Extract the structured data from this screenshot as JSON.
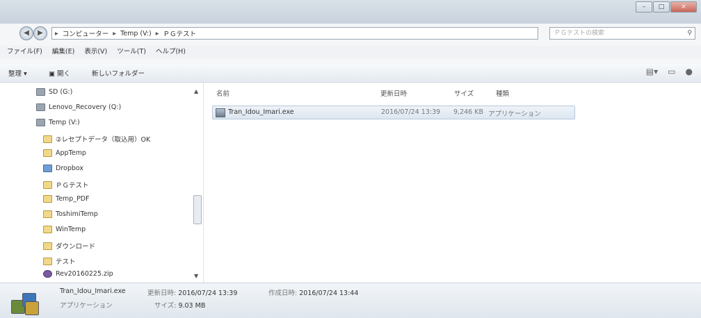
{
  "window": {
    "buttons": [
      "–",
      "□",
      "×"
    ]
  },
  "nav": {
    "back_icon": "back-arrow-icon",
    "forward_icon": "forward-arrow-icon",
    "breadcrumb": [
      "コンピューター",
      "Temp (V:)",
      "ＰＧテスト"
    ],
    "search_placeholder": "ＰＧテストの検索"
  },
  "menu": [
    "ファイル(F)",
    "編集(E)",
    "表示(V)",
    "ツール(T)",
    "ヘルプ(H)"
  ],
  "toolbar": {
    "organize": "整理 ▾",
    "open": "開く",
    "new_folder": "新しいフォルダー"
  },
  "navpane": {
    "items": [
      {
        "label": "SD (G:)",
        "icon": "drive"
      },
      {
        "label": "Lenovo_Recovery (Q:)",
        "icon": "drive"
      },
      {
        "label": "Temp (V:)",
        "icon": "drive"
      },
      {
        "label": "②レセプトデータ（取込用）OK",
        "icon": "folder"
      },
      {
        "label": "AppTemp",
        "icon": "folder"
      },
      {
        "label": "Dropbox",
        "icon": "box"
      },
      {
        "label": "ＰＧテスト",
        "icon": "folder"
      },
      {
        "label": "Temp_PDF",
        "icon": "folder"
      },
      {
        "label": "ToshimiTemp",
        "icon": "folder"
      },
      {
        "label": "WinTemp",
        "icon": "folder"
      },
      {
        "label": "ダウンロード",
        "icon": "folder"
      },
      {
        "label": "テスト",
        "icon": "folder"
      },
      {
        "label": "Rev20160225.zip",
        "icon": "zip"
      }
    ]
  },
  "list": {
    "columns": [
      "名前",
      "更新日時",
      "サイズ",
      "種類"
    ],
    "rows": [
      {
        "name": "Tran_Idou_Imari.exe",
        "modified": "2016/07/24 13:39",
        "size": "9,246 KB",
        "type": "アプリケーション"
      }
    ]
  },
  "details": {
    "filename": "Tran_Idou_Imari.exe",
    "modified_label": "更新日時:",
    "modified": "2016/07/24 13:39",
    "created_label": "作成日時:",
    "created": "2016/07/24 13:44",
    "type": "アプリケーション",
    "size_label": "サイズ:",
    "size": "9.03 MB"
  }
}
